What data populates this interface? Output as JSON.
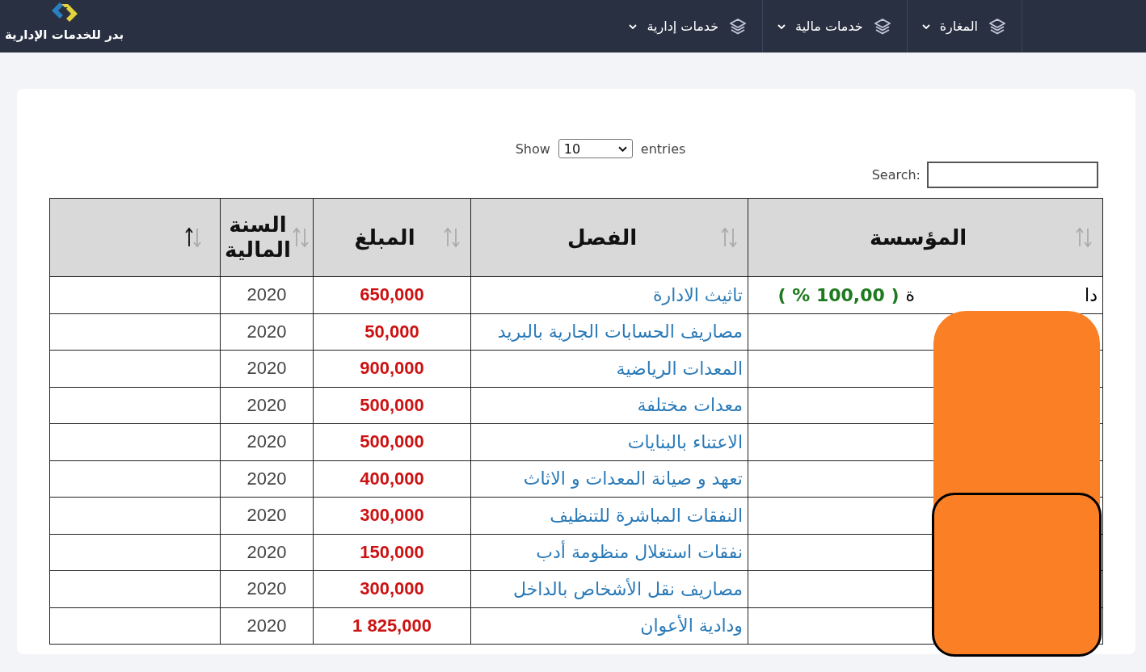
{
  "brand": {
    "name": "بدر للخدمات الإدارية"
  },
  "nav": [
    {
      "label": "المغارة"
    },
    {
      "label": "خدمات مالية"
    },
    {
      "label": "خدمات إدارية"
    }
  ],
  "length_control": {
    "prefix": "Show",
    "value": "10",
    "suffix": "entries"
  },
  "search": {
    "label": "Search:"
  },
  "table": {
    "columns": [
      {
        "label": "المؤسسة",
        "sorted": false
      },
      {
        "label": "الفصل",
        "sorted": false
      },
      {
        "label": "المبلغ",
        "sorted": false
      },
      {
        "label": "السنة المالية",
        "sorted": false
      },
      {
        "sorted": true
      }
    ],
    "rows": [
      {
        "institution": {
          "start": "دا",
          "end": "ة",
          "share": "( % 100,00 )"
        },
        "chapter": "تاثيث الادارة",
        "amount": "650,000",
        "year": "2020"
      },
      {
        "chapter": "مصاريف الحسابات الجارية بالبريد",
        "amount": "50,000",
        "year": "2020"
      },
      {
        "chapter": "المعدات الرياضية",
        "amount": "900,000",
        "year": "2020"
      },
      {
        "chapter": "معدات مختلفة",
        "amount": "500,000",
        "year": "2020"
      },
      {
        "chapter": "الاعتناء بالبنايات",
        "amount": "500,000",
        "year": "2020"
      },
      {
        "chapter": "تعهد و صيانة المعدات و الاثاث",
        "amount": "400,000",
        "year": "2020"
      },
      {
        "chapter": "النفقات المباشرة للتنظيف",
        "amount": "300,000",
        "year": "2020"
      },
      {
        "chapter": "نفقات استغلال منظومة أدب",
        "amount": "150,000",
        "year": "2020"
      },
      {
        "chapter": "مصاريف نقل الأشخاص بالداخل",
        "amount": "300,000",
        "year": "2020"
      },
      {
        "chapter": "ودادية الأعوان",
        "amount": "1 825,000",
        "year": "2020"
      }
    ]
  },
  "redactions": [
    {
      "kind": "fill"
    },
    {
      "kind": "outlined"
    }
  ]
}
